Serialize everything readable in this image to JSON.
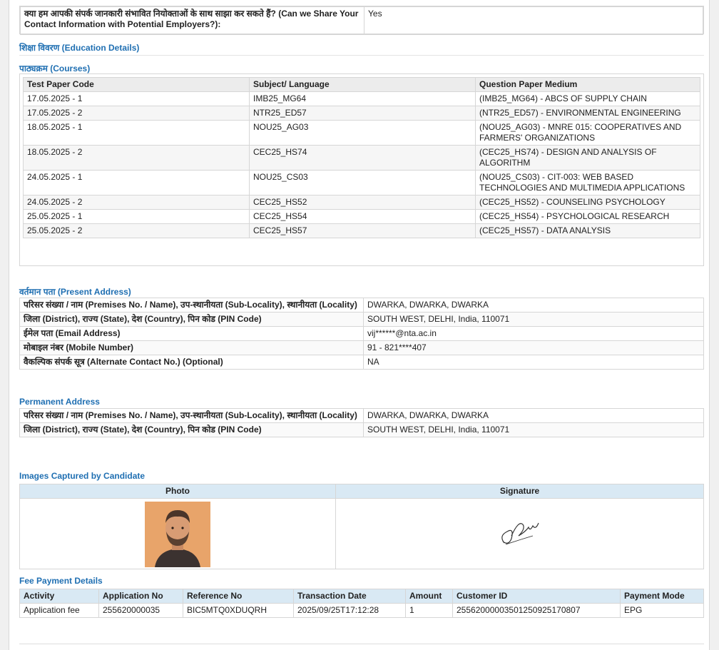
{
  "share": {
    "question": "क्या हम आपकी संपर्क जानकारी संभावित नियोक्ताओं के साथ साझा कर सकते हैं? (Can we Share Your Contact Information with Potential Employers?):",
    "answer": "Yes"
  },
  "education": {
    "title": "शिक्षा विवरण (Education Details)",
    "courses_title": "पाठ्यक्रम (Courses)",
    "headers": [
      "Test Paper Code",
      "Subject/ Language",
      "Question Paper Medium"
    ],
    "rows": [
      [
        "17.05.2025 - 1",
        "IMB25_MG64",
        "(IMB25_MG64) - ABCS OF SUPPLY CHAIN"
      ],
      [
        "17.05.2025 - 2",
        "NTR25_ED57",
        "(NTR25_ED57) - ENVIRONMENTAL ENGINEERING"
      ],
      [
        "18.05.2025 - 1",
        "NOU25_AG03",
        "(NOU25_AG03) - MNRE 015: COOPERATIVES AND FARMERS' ORGANIZATIONS"
      ],
      [
        "18.05.2025 - 2",
        "CEC25_HS74",
        "(CEC25_HS74) - DESIGN AND ANALYSIS OF ALGORITHM"
      ],
      [
        "24.05.2025 - 1",
        "NOU25_CS03",
        "(NOU25_CS03) - CIT-003: WEB BASED TECHNOLOGIES AND MULTIMEDIA APPLICATIONS"
      ],
      [
        "24.05.2025 - 2",
        "CEC25_HS52",
        "(CEC25_HS52) - COUNSELING PSYCHOLOGY"
      ],
      [
        "25.05.2025 - 1",
        "CEC25_HS54",
        "(CEC25_HS54) - PSYCHOLOGICAL RESEARCH"
      ],
      [
        "25.05.2025 - 2",
        "CEC25_HS57",
        "(CEC25_HS57) - DATA ANALYSIS"
      ]
    ]
  },
  "present_address": {
    "title": "वर्तमान पता (Present Address)",
    "rows": [
      [
        "परिसर संख्या / नाम (Premises No. / Name), उप-स्थानीयता (Sub-Locality), स्थानीयता (Locality)",
        "DWARKA, DWARKA, DWARKA"
      ],
      [
        "जिला (District), राज्य (State), देश (Country), पिन कोड (PIN Code)",
        "SOUTH WEST, DELHI, India, 110071"
      ],
      [
        "ईमेल पता (Email Address)",
        "vij******@nta.ac.in"
      ],
      [
        "मोबाइल नंबर (Mobile Number)",
        "91 - 821****407"
      ],
      [
        "वैकल्पिक संपर्क सूत्र (Alternate Contact No.) (Optional)",
        "NA"
      ]
    ]
  },
  "permanent_address": {
    "title": "Permanent Address",
    "rows": [
      [
        "परिसर संख्या / नाम (Premises No. / Name), उप-स्थानीयता (Sub-Locality), स्थानीयता (Locality)",
        "DWARKA, DWARKA, DWARKA"
      ],
      [
        "जिला (District), राज्य (State), देश (Country), पिन कोड (PIN Code)",
        "SOUTH WEST, DELHI, India, 110071"
      ]
    ]
  },
  "images": {
    "title": "Images Captured by Candidate",
    "photo_label": "Photo",
    "signature_label": "Signature"
  },
  "fee": {
    "title": "Fee Payment Details",
    "headers": [
      "Activity",
      "Application No",
      "Reference No",
      "Transaction Date",
      "Amount",
      "Customer ID",
      "Payment Mode"
    ],
    "rows": [
      [
        "Application fee",
        "255620000035",
        "BIC5MTQ0XDUQRH",
        "2025/09/25T17:12:28",
        "1",
        "25562000003501250925170807",
        "EPG"
      ]
    ]
  },
  "colors": {
    "section_title": "#1f6fb2",
    "table_header_blue": "#d9e9f4"
  }
}
